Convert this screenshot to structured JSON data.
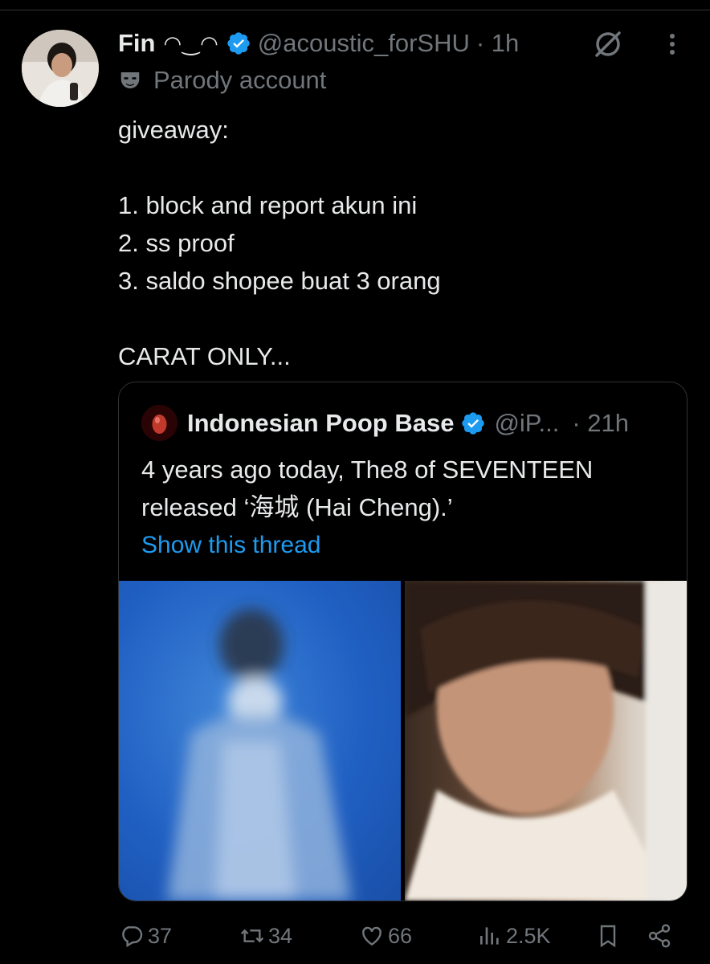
{
  "tweet": {
    "author_name": "Fin",
    "author_emoticon": "◠‿◠",
    "handle": "@acoustic_forSHU",
    "time": "· 1h",
    "label": "Parody account",
    "lines": [
      "giveaway:",
      "",
      "1. block and report akun ini",
      "2. ss proof",
      "3. saldo shopee buat 3 orang",
      "",
      "CARAT ONLY..."
    ]
  },
  "quote": {
    "name": "Indonesian Poop Base",
    "handle": "@iP...",
    "time": "· 21h",
    "line1": "4 years ago today, The8 of SEVENTEEN",
    "line2": "released ‘海城 (Hai Cheng).’",
    "link": "Show this thread"
  },
  "actions": {
    "replies": "37",
    "reposts": "34",
    "likes": "66",
    "views": "2.5K"
  },
  "colors": {
    "background": "#000000",
    "text": "#e7e9ea",
    "muted": "#71767b",
    "accent": "#1d9bf0",
    "border": "#2f3336"
  },
  "icons": [
    "verified-badge-icon",
    "grok-icon",
    "more-icon",
    "parody-mask-icon",
    "reply-icon",
    "repost-icon",
    "like-icon",
    "views-icon",
    "bookmark-icon",
    "share-icon"
  ]
}
